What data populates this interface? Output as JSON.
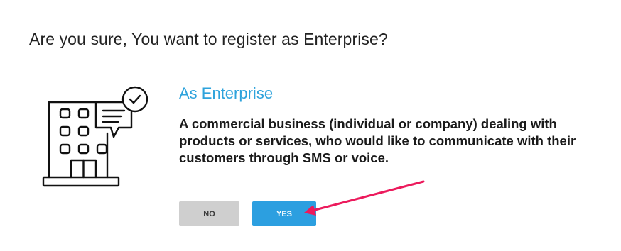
{
  "dialog": {
    "question": "Are you sure, You want to register as Enterprise?"
  },
  "option": {
    "title": "As Enterprise",
    "description": "A commercial business (individual or company) dealing with products or services, who would like to communicate with their customers through SMS or voice.",
    "icon": "enterprise-building-icon"
  },
  "buttons": {
    "no_label": "NO",
    "yes_label": "YES"
  },
  "colors": {
    "accent": "#2ea3dc",
    "yes_button": "#2c9fe0",
    "no_button": "#cfcfcf",
    "annotation_arrow": "#ec1a5c"
  }
}
